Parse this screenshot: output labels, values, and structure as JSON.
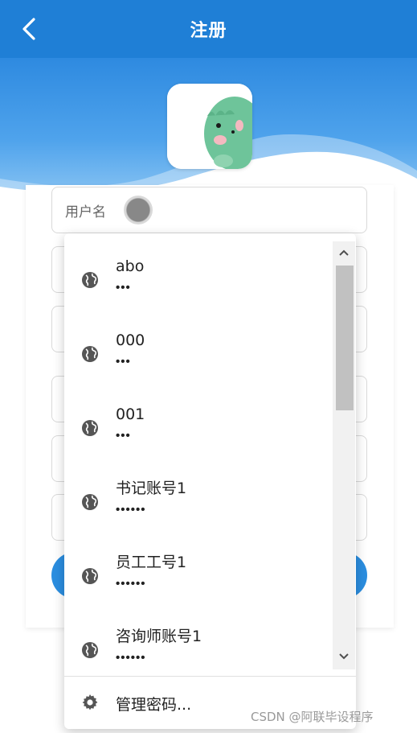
{
  "header": {
    "title": "注册",
    "back_icon": "chevron-left-icon"
  },
  "colors": {
    "header_bg": "#1f7fd6",
    "hero_blue": "#2e8ae0",
    "button_blue": "#2b8ee0"
  },
  "form": {
    "username_label": "用户名"
  },
  "autofill": {
    "items": [
      {
        "username": "abo",
        "password": "•••",
        "icon": "globe-icon"
      },
      {
        "username": "000",
        "password": "•••",
        "icon": "globe-icon"
      },
      {
        "username": "001",
        "password": "•••",
        "icon": "globe-icon"
      },
      {
        "username": "书记账号1",
        "password": "••••••",
        "icon": "globe-icon"
      },
      {
        "username": "员工工号1",
        "password": "••••••",
        "icon": "globe-icon"
      },
      {
        "username": "咨询师账号1",
        "password": "••••••",
        "icon": "globe-icon"
      }
    ],
    "manage_label": "管理密码...",
    "manage_icon": "gear-icon"
  },
  "watermark": "CSDN @阿联毕设程序"
}
